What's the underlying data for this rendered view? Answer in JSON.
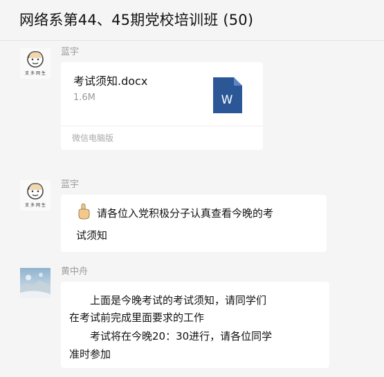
{
  "header": {
    "title": "网络系第44、45期党校培训班 (50)"
  },
  "messages": [
    {
      "sender": "蓝宇",
      "avatar": "cartoon-boy-avatar",
      "type": "file",
      "file": {
        "name": "考试须知.docx",
        "size": "1.6M",
        "source": "微信电脑版",
        "icon": "word-document-icon",
        "icon_letter": "W",
        "icon_color": "#2b5797"
      }
    },
    {
      "sender": "蓝宇",
      "avatar": "cartoon-boy-avatar",
      "type": "text",
      "emoji": "pointing-hand-icon",
      "lines": [
        "请各位入党积极分子认真查看今晚的考",
        "试须知"
      ]
    },
    {
      "sender": "黄中舟",
      "avatar": "landscape-photo-avatar",
      "type": "text",
      "lines": [
        "上面是今晚考试的考试须知，请同学们",
        "在考试前完成里面要求的工作",
        "考试将在今晚20：30进行，请各位同学",
        "准时参加"
      ]
    }
  ]
}
